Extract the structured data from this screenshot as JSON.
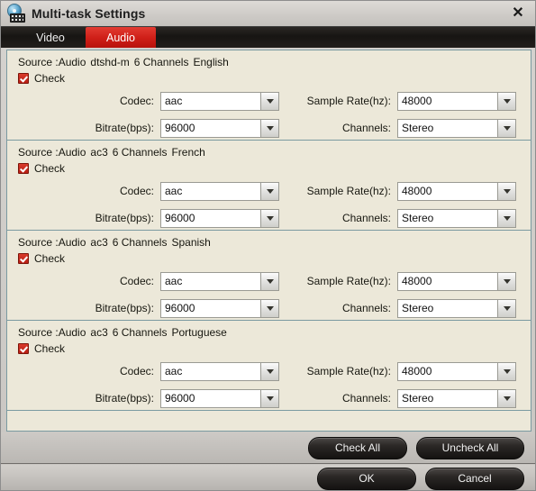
{
  "window": {
    "title": "Multi-task Settings",
    "icon": "disc-film-icon",
    "close_label": "✕"
  },
  "tabs": [
    {
      "label": "Video",
      "active": false
    },
    {
      "label": "Audio",
      "active": true
    }
  ],
  "labels": {
    "check": "Check",
    "codec": "Codec:",
    "bitrate": "Bitrate(bps):",
    "sample_rate": "Sample Rate(hz):",
    "channels": "Channels:"
  },
  "audio_tracks": [
    {
      "source_prefix": "Source :Audio",
      "codec_name": "dtshd-m",
      "channel_count": "6 Channels",
      "language": "English",
      "checked": true,
      "codec": "aac",
      "bitrate": "96000",
      "sample_rate": "48000",
      "channels": "Stereo"
    },
    {
      "source_prefix": "Source :Audio",
      "codec_name": "ac3",
      "channel_count": "6 Channels",
      "language": "French",
      "checked": true,
      "codec": "aac",
      "bitrate": "96000",
      "sample_rate": "48000",
      "channels": "Stereo"
    },
    {
      "source_prefix": "Source :Audio",
      "codec_name": "ac3",
      "channel_count": "6 Channels",
      "language": "Spanish",
      "checked": true,
      "codec": "aac",
      "bitrate": "96000",
      "sample_rate": "48000",
      "channels": "Stereo"
    },
    {
      "source_prefix": "Source :Audio",
      "codec_name": "ac3",
      "channel_count": "6 Channels",
      "language": "Portuguese",
      "checked": true,
      "codec": "aac",
      "bitrate": "96000",
      "sample_rate": "48000",
      "channels": "Stereo"
    }
  ],
  "footer": {
    "check_all": "Check All",
    "uncheck_all": "Uncheck All",
    "ok": "OK",
    "cancel": "Cancel"
  },
  "colors": {
    "accent_red": "#cf1f18",
    "panel_bg": "#ece8d9",
    "panel_border": "#7b9aa1",
    "titlebar": "#d6d3cf",
    "tabbar": "#171513"
  }
}
